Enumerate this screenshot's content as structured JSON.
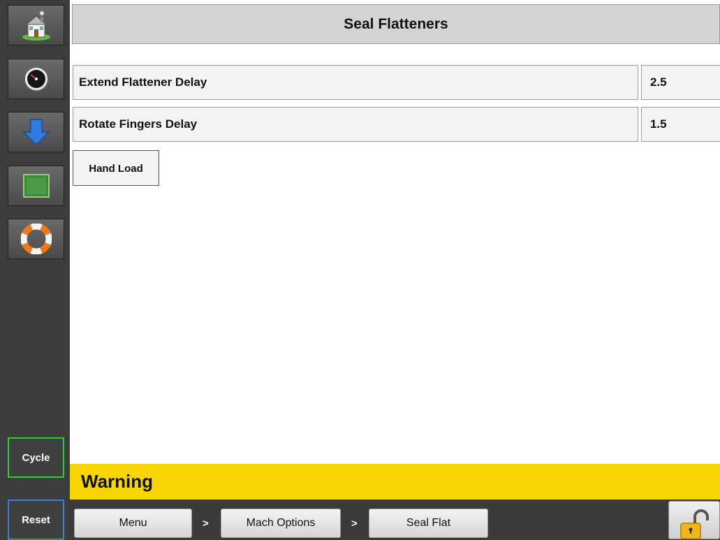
{
  "sidebar": {
    "nav": [
      {
        "icon": "home-icon"
      },
      {
        "icon": "gauge-icon"
      },
      {
        "icon": "download-arrow-icon"
      },
      {
        "icon": "cpu-chip-icon"
      },
      {
        "icon": "lifebuoy-icon"
      }
    ],
    "cycle_label": "Cycle",
    "reset_label": "Reset"
  },
  "header": {
    "title": "Seal Flatteners"
  },
  "params": [
    {
      "label": "Extend Flattener Delay",
      "value": "2.5"
    },
    {
      "label": "Rotate Fingers Delay",
      "value": "1.5"
    }
  ],
  "hand_load_label": "Hand Load",
  "warning": {
    "text": "Warning",
    "color": "#f9d500"
  },
  "breadcrumb": {
    "items": [
      "Menu",
      "Mach Options",
      "Seal Flat"
    ],
    "separator": ">"
  },
  "lock": {
    "icon": "unlocked-padlock-icon"
  },
  "colors": {
    "sidebar_bg": "#3c3c3c",
    "cycle_border": "#2ecc2e",
    "reset_border": "#3b7fd6"
  }
}
